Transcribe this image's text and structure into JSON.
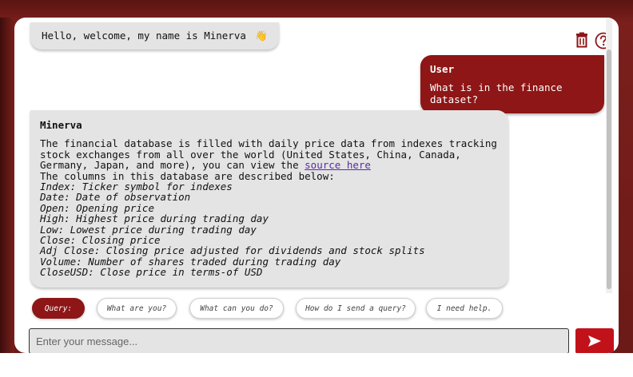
{
  "greeting": {
    "text": "Hello, welcome, my name is Minerva",
    "emoji": "👋"
  },
  "toolbar": {
    "delete_icon": "trash-icon",
    "help_icon": "help-circle-icon"
  },
  "user_message": {
    "sender": "User",
    "text": "What is in the finance dataset?"
  },
  "bot_message": {
    "sender": "Minerva",
    "intro_before_link": "The financial database is filled with daily price data from indexes tracking stock exchanges from all over the world (United States, China, Canada, Germany, Japan, and more), you can view the ",
    "link_text": "source here",
    "columns_intro": "The columns in this database are described below:",
    "columns": [
      "Index: Ticker symbol for indexes",
      "Date: Date of observation",
      "Open: Opening price",
      "High: Highest price during trading day",
      "Low: Lowest price during trading day",
      "Close: Closing price",
      "Adj Close: Closing price adjusted for dividends and stock splits",
      "Volume: Number of shares traded during trading day",
      "CloseUSD: Close price in terms-of USD"
    ]
  },
  "suggestions": {
    "query_label": "Query:",
    "chips": [
      "What are you?",
      "What can you do?",
      "How do I send a query?",
      "I need help."
    ]
  },
  "composer": {
    "placeholder": "Enter your message...",
    "send_icon": "send-arrow-icon"
  },
  "colors": {
    "accent": "#8e1616",
    "send": "#c1121a",
    "bubble": "#e4e4e4"
  }
}
